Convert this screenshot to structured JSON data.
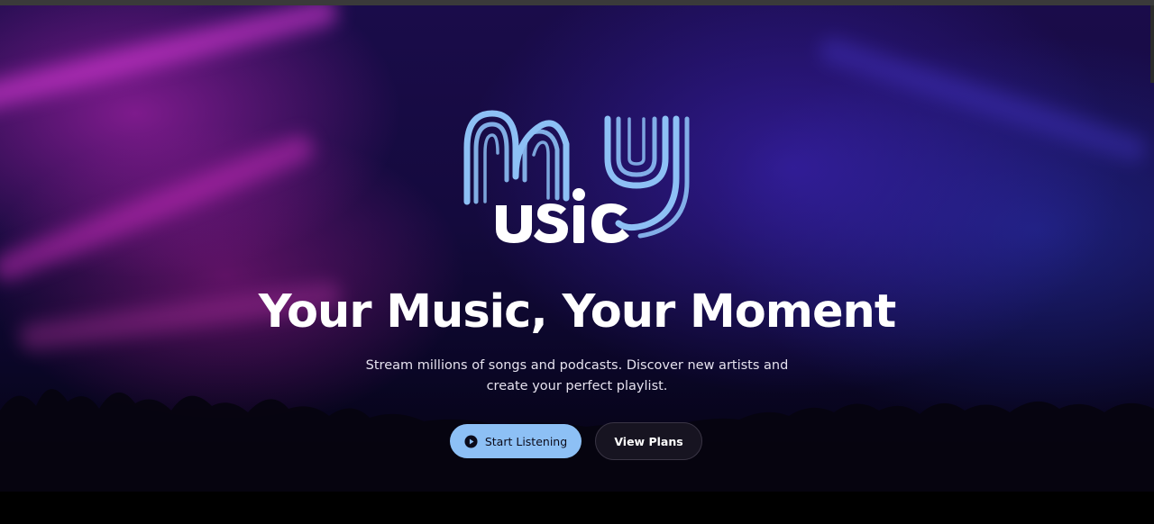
{
  "hero": {
    "logo_alt": "MyMusic",
    "headline": "Your Music, Your Moment",
    "subtitle": "Stream millions of songs and podcasts. Discover new artists and create your perfect playlist.",
    "primary_button": {
      "label": "Start Listening",
      "icon": "play-circle-icon"
    },
    "secondary_button": {
      "label": "View Plans"
    }
  },
  "colors": {
    "accent": "#8dc0f5",
    "secondary_button_bg": "#171421",
    "headline": "#ffffff",
    "background_top": "#1a0c4a"
  }
}
